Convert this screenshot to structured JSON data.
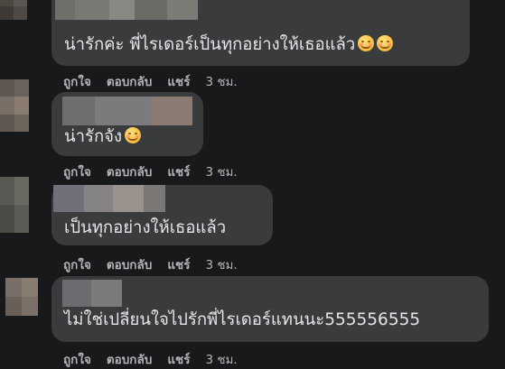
{
  "actions": {
    "like": "ถูกใจ",
    "reply": "ตอบกลับ",
    "share": "แชร์",
    "time": "3 ชม."
  },
  "comments": [
    {
      "text": "น่ารักค่ะ พี่ไรเดอร์เป็นทุกอย่างให้เธอแล้ว",
      "emoji": [
        "smiling-face-icon",
        "smiling-face-icon"
      ]
    },
    {
      "text": "น่ารักจัง",
      "emoji": [
        "smiling-face-icon"
      ]
    },
    {
      "text": "เป็นทุกอย่างให้เธอแล้ว",
      "emoji": []
    },
    {
      "text": "ไม่ใช่เปลี่ยนใจไปรักพี่ไรเดอร์แทนนะ555556555",
      "emoji": []
    }
  ]
}
